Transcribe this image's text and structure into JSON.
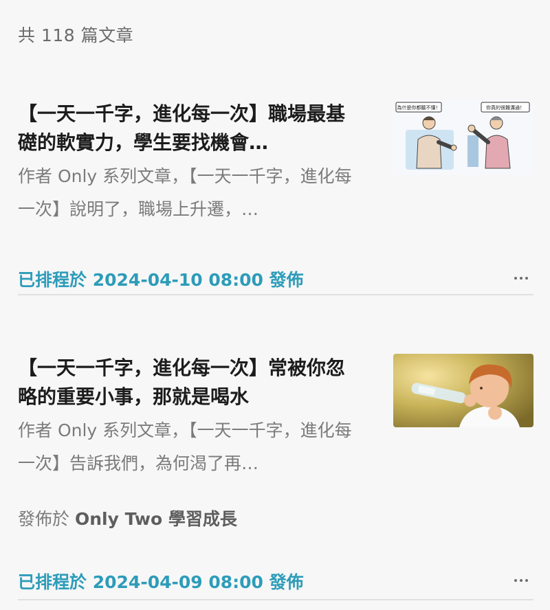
{
  "header": {
    "article_count": "共 118 篇文章"
  },
  "articles": [
    {
      "title": "【一天一千字，進化每一次】職場最基礎的軟實力，學生要找機會…",
      "summary": "作者 Only 系列文章，【一天一千字，進化每一次】說明了，職場上升遷，…",
      "thumbnail_bubble_left": "為什麼你都聽不懂！",
      "thumbnail_bubble_right": "你真的很難溝通！",
      "scheduled_prefix": "已排程於",
      "scheduled_time": "2024-04-10 08:00",
      "scheduled_suffix": "發佈"
    },
    {
      "title": "【一天一千字，進化每一次】常被你忽略的重要小事，那就是喝水",
      "summary": "作者 Only 系列文章，【一天一千字，進化每一次】告訴我們，為何渴了再…",
      "published_prefix": "發佈於",
      "published_publication": "Only Two 學習成長",
      "scheduled_prefix": "已排程於",
      "scheduled_time": "2024-04-09 08:00",
      "scheduled_suffix": "發佈"
    }
  ],
  "colors": {
    "accent": "#2d9cb9",
    "title": "#1c1c1c",
    "muted": "#7b7b7b",
    "background": "#f7f7f7"
  },
  "icons": {
    "more": "more-horizontal-icon"
  }
}
